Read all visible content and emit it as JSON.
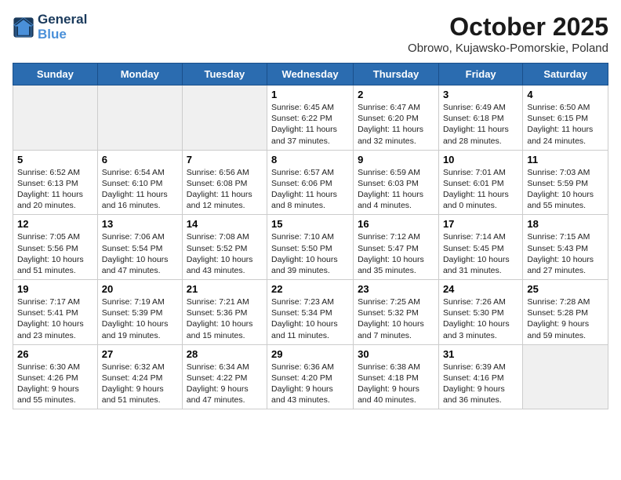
{
  "header": {
    "logo_line1": "General",
    "logo_line2": "Blue",
    "month_title": "October 2025",
    "location": "Obrowo, Kujawsko-Pomorskie, Poland"
  },
  "day_headers": [
    "Sunday",
    "Monday",
    "Tuesday",
    "Wednesday",
    "Thursday",
    "Friday",
    "Saturday"
  ],
  "weeks": [
    [
      {
        "date": "",
        "text": ""
      },
      {
        "date": "",
        "text": ""
      },
      {
        "date": "",
        "text": ""
      },
      {
        "date": "1",
        "text": "Sunrise: 6:45 AM\nSunset: 6:22 PM\nDaylight: 11 hours and 37 minutes."
      },
      {
        "date": "2",
        "text": "Sunrise: 6:47 AM\nSunset: 6:20 PM\nDaylight: 11 hours and 32 minutes."
      },
      {
        "date": "3",
        "text": "Sunrise: 6:49 AM\nSunset: 6:18 PM\nDaylight: 11 hours and 28 minutes."
      },
      {
        "date": "4",
        "text": "Sunrise: 6:50 AM\nSunset: 6:15 PM\nDaylight: 11 hours and 24 minutes."
      }
    ],
    [
      {
        "date": "5",
        "text": "Sunrise: 6:52 AM\nSunset: 6:13 PM\nDaylight: 11 hours and 20 minutes."
      },
      {
        "date": "6",
        "text": "Sunrise: 6:54 AM\nSunset: 6:10 PM\nDaylight: 11 hours and 16 minutes."
      },
      {
        "date": "7",
        "text": "Sunrise: 6:56 AM\nSunset: 6:08 PM\nDaylight: 11 hours and 12 minutes."
      },
      {
        "date": "8",
        "text": "Sunrise: 6:57 AM\nSunset: 6:06 PM\nDaylight: 11 hours and 8 minutes."
      },
      {
        "date": "9",
        "text": "Sunrise: 6:59 AM\nSunset: 6:03 PM\nDaylight: 11 hours and 4 minutes."
      },
      {
        "date": "10",
        "text": "Sunrise: 7:01 AM\nSunset: 6:01 PM\nDaylight: 11 hours and 0 minutes."
      },
      {
        "date": "11",
        "text": "Sunrise: 7:03 AM\nSunset: 5:59 PM\nDaylight: 10 hours and 55 minutes."
      }
    ],
    [
      {
        "date": "12",
        "text": "Sunrise: 7:05 AM\nSunset: 5:56 PM\nDaylight: 10 hours and 51 minutes."
      },
      {
        "date": "13",
        "text": "Sunrise: 7:06 AM\nSunset: 5:54 PM\nDaylight: 10 hours and 47 minutes."
      },
      {
        "date": "14",
        "text": "Sunrise: 7:08 AM\nSunset: 5:52 PM\nDaylight: 10 hours and 43 minutes."
      },
      {
        "date": "15",
        "text": "Sunrise: 7:10 AM\nSunset: 5:50 PM\nDaylight: 10 hours and 39 minutes."
      },
      {
        "date": "16",
        "text": "Sunrise: 7:12 AM\nSunset: 5:47 PM\nDaylight: 10 hours and 35 minutes."
      },
      {
        "date": "17",
        "text": "Sunrise: 7:14 AM\nSunset: 5:45 PM\nDaylight: 10 hours and 31 minutes."
      },
      {
        "date": "18",
        "text": "Sunrise: 7:15 AM\nSunset: 5:43 PM\nDaylight: 10 hours and 27 minutes."
      }
    ],
    [
      {
        "date": "19",
        "text": "Sunrise: 7:17 AM\nSunset: 5:41 PM\nDaylight: 10 hours and 23 minutes."
      },
      {
        "date": "20",
        "text": "Sunrise: 7:19 AM\nSunset: 5:39 PM\nDaylight: 10 hours and 19 minutes."
      },
      {
        "date": "21",
        "text": "Sunrise: 7:21 AM\nSunset: 5:36 PM\nDaylight: 10 hours and 15 minutes."
      },
      {
        "date": "22",
        "text": "Sunrise: 7:23 AM\nSunset: 5:34 PM\nDaylight: 10 hours and 11 minutes."
      },
      {
        "date": "23",
        "text": "Sunrise: 7:25 AM\nSunset: 5:32 PM\nDaylight: 10 hours and 7 minutes."
      },
      {
        "date": "24",
        "text": "Sunrise: 7:26 AM\nSunset: 5:30 PM\nDaylight: 10 hours and 3 minutes."
      },
      {
        "date": "25",
        "text": "Sunrise: 7:28 AM\nSunset: 5:28 PM\nDaylight: 9 hours and 59 minutes."
      }
    ],
    [
      {
        "date": "26",
        "text": "Sunrise: 6:30 AM\nSunset: 4:26 PM\nDaylight: 9 hours and 55 minutes."
      },
      {
        "date": "27",
        "text": "Sunrise: 6:32 AM\nSunset: 4:24 PM\nDaylight: 9 hours and 51 minutes."
      },
      {
        "date": "28",
        "text": "Sunrise: 6:34 AM\nSunset: 4:22 PM\nDaylight: 9 hours and 47 minutes."
      },
      {
        "date": "29",
        "text": "Sunrise: 6:36 AM\nSunset: 4:20 PM\nDaylight: 9 hours and 43 minutes."
      },
      {
        "date": "30",
        "text": "Sunrise: 6:38 AM\nSunset: 4:18 PM\nDaylight: 9 hours and 40 minutes."
      },
      {
        "date": "31",
        "text": "Sunrise: 6:39 AM\nSunset: 4:16 PM\nDaylight: 9 hours and 36 minutes."
      },
      {
        "date": "",
        "text": ""
      }
    ]
  ]
}
